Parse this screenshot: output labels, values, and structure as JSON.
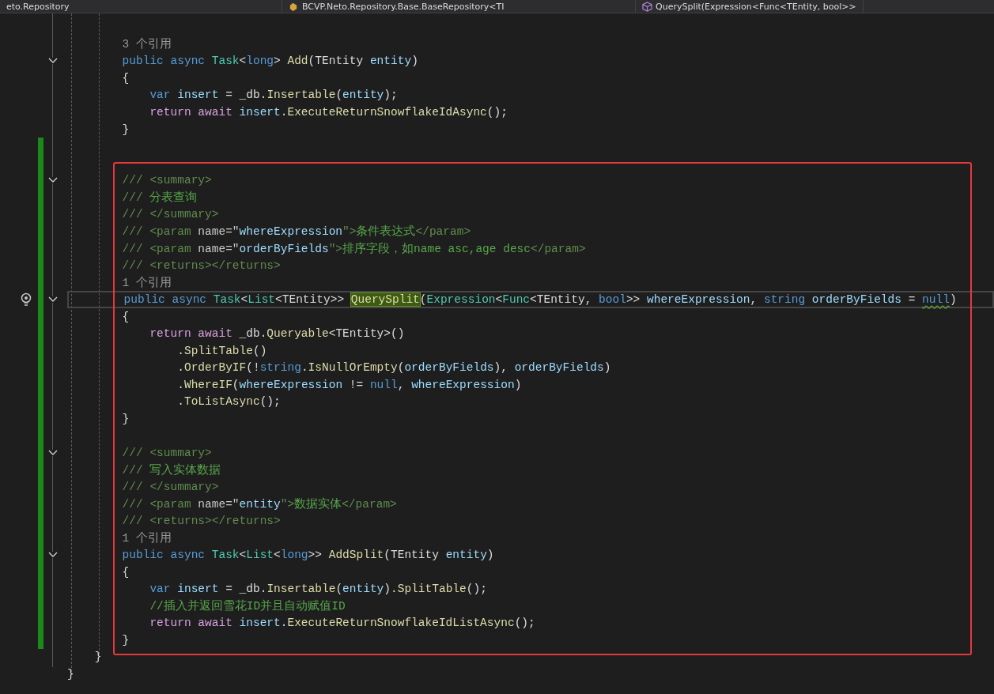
{
  "navigation_bar": [
    {
      "text": "eto.Repository"
    },
    {
      "text": "BCVP.Neto.Repository.Base.BaseRepository<TI"
    },
    {
      "text": "QuerySplit(Expression<Func<TEntity, bool>>"
    }
  ],
  "regions": [
    {
      "changed": false,
      "blocks": [
        {
          "lines": [
            {
              "tokens": [
                {
                  "text": "        3 个引用",
                  "kind": "lens"
                }
              ]
            },
            {
              "fold": true,
              "tokens": [
                {
                  "text": "        public async ",
                  "kind": "keyword"
                },
                {
                  "text": "Task",
                  "kind": "type"
                },
                {
                  "text": "<",
                  "kind": "plain"
                },
                {
                  "text": "long",
                  "kind": "keyword"
                },
                {
                  "text": "> ",
                  "kind": "plain"
                },
                {
                  "text": "Add",
                  "kind": "method"
                },
                {
                  "text": "(",
                  "kind": "plain"
                },
                {
                  "text": "TEntity ",
                  "kind": "plain"
                },
                {
                  "text": "entity",
                  "kind": "param"
                },
                {
                  "text": ")",
                  "kind": "plain"
                }
              ]
            },
            {
              "tokens": [
                {
                  "text": "        {",
                  "kind": "plain"
                }
              ]
            },
            {
              "tokens": [
                {
                  "text": "            var ",
                  "kind": "keyword"
                },
                {
                  "text": "insert",
                  "kind": "param"
                },
                {
                  "text": " = _db.",
                  "kind": "plain"
                },
                {
                  "text": "Insertable",
                  "kind": "method"
                },
                {
                  "text": "(",
                  "kind": "plain"
                },
                {
                  "text": "entity",
                  "kind": "param"
                },
                {
                  "text": ");",
                  "kind": "plain"
                }
              ]
            },
            {
              "tokens": [
                {
                  "text": "            return await ",
                  "kind": "control"
                },
                {
                  "text": "insert",
                  "kind": "param"
                },
                {
                  "text": ".",
                  "kind": "plain"
                },
                {
                  "text": "ExecuteReturnSnowflakeIdAsync",
                  "kind": "method"
                },
                {
                  "text": "();",
                  "kind": "plain"
                }
              ]
            },
            {
              "tokens": [
                {
                  "text": "        }",
                  "kind": "plain"
                }
              ]
            }
          ]
        }
      ]
    },
    {
      "changed": true,
      "blocks": [
        {
          "lines": [
            {
              "fold": true,
              "tokens": [
                {
                  "text": "        /// <summary>",
                  "kind": "doc"
                }
              ]
            },
            {
              "tokens": [
                {
                  "text": "        ///",
                  "kind": "doc"
                },
                {
                  "text": " 分表查询",
                  "kind": "comment"
                }
              ]
            },
            {
              "tokens": [
                {
                  "text": "        /// </summary>",
                  "kind": "doc"
                }
              ]
            },
            {
              "tokens": [
                {
                  "text": "        /// <param ",
                  "kind": "doc"
                },
                {
                  "text": "name=\"",
                  "kind": "attr"
                },
                {
                  "text": "whereExpression",
                  "kind": "param"
                },
                {
                  "text": "\">",
                  "kind": "doc"
                },
                {
                  "text": "条件表达式",
                  "kind": "comment"
                },
                {
                  "text": "</param>",
                  "kind": "doc"
                }
              ]
            },
            {
              "tokens": [
                {
                  "text": "        /// <param ",
                  "kind": "doc"
                },
                {
                  "text": "name=\"",
                  "kind": "attr"
                },
                {
                  "text": "orderByFields",
                  "kind": "param"
                },
                {
                  "text": "\">",
                  "kind": "doc"
                },
                {
                  "text": "排序字段，如name asc,age desc",
                  "kind": "comment"
                },
                {
                  "text": "</param>",
                  "kind": "doc"
                }
              ]
            },
            {
              "tokens": [
                {
                  "text": "        /// <returns></returns>",
                  "kind": "doc"
                }
              ]
            },
            {
              "tokens": [
                {
                  "text": "        1 个引用",
                  "kind": "lens"
                }
              ]
            },
            {
              "fold": true,
              "current": true,
              "lightbulb": true,
              "tokens": [
                {
                  "text": "        public async ",
                  "kind": "keyword"
                },
                {
                  "text": "Task",
                  "kind": "type"
                },
                {
                  "text": "<",
                  "kind": "plain"
                },
                {
                  "text": "List",
                  "kind": "type"
                },
                {
                  "text": "<",
                  "kind": "plain"
                },
                {
                  "text": "TEntity",
                  "kind": "plain"
                },
                {
                  "text": ">> ",
                  "kind": "plain"
                },
                {
                  "text": "QuerySplit",
                  "kind": "highlight"
                },
                {
                  "text": "(",
                  "kind": "plain"
                },
                {
                  "text": "Expression",
                  "kind": "type"
                },
                {
                  "text": "<",
                  "kind": "plain"
                },
                {
                  "text": "Func",
                  "kind": "type"
                },
                {
                  "text": "<",
                  "kind": "plain"
                },
                {
                  "text": "TEntity",
                  "kind": "plain"
                },
                {
                  "text": ", ",
                  "kind": "plain"
                },
                {
                  "text": "bool",
                  "kind": "keyword"
                },
                {
                  "text": ">> ",
                  "kind": "plain"
                },
                {
                  "text": "whereExpression",
                  "kind": "param"
                },
                {
                  "text": ", ",
                  "kind": "plain"
                },
                {
                  "text": "string ",
                  "kind": "keyword"
                },
                {
                  "text": "orderByFields",
                  "kind": "param"
                },
                {
                  "text": " = ",
                  "kind": "plain"
                },
                {
                  "text": "null",
                  "kind": "warning"
                },
                {
                  "text": ")",
                  "kind": "plain"
                }
              ]
            },
            {
              "tokens": [
                {
                  "text": "        {",
                  "kind": "plain"
                }
              ]
            },
            {
              "tokens": [
                {
                  "text": "            return await ",
                  "kind": "control"
                },
                {
                  "text": "_db.",
                  "kind": "plain"
                },
                {
                  "text": "Queryable",
                  "kind": "method"
                },
                {
                  "text": "<TEntity>()",
                  "kind": "plain"
                }
              ]
            },
            {
              "tokens": [
                {
                  "text": "                .",
                  "kind": "plain"
                },
                {
                  "text": "SplitTable",
                  "kind": "method"
                },
                {
                  "text": "()",
                  "kind": "plain"
                }
              ]
            },
            {
              "tokens": [
                {
                  "text": "                .",
                  "kind": "plain"
                },
                {
                  "text": "OrderByIF",
                  "kind": "method"
                },
                {
                  "text": "(!",
                  "kind": "plain"
                },
                {
                  "text": "string",
                  "kind": "keyword"
                },
                {
                  "text": ".",
                  "kind": "plain"
                },
                {
                  "text": "IsNullOrEmpty",
                  "kind": "method"
                },
                {
                  "text": "(",
                  "kind": "plain"
                },
                {
                  "text": "orderByFields",
                  "kind": "param"
                },
                {
                  "text": "), ",
                  "kind": "plain"
                },
                {
                  "text": "orderByFields",
                  "kind": "param"
                },
                {
                  "text": ")",
                  "kind": "plain"
                }
              ]
            },
            {
              "tokens": [
                {
                  "text": "                .",
                  "kind": "plain"
                },
                {
                  "text": "WhereIF",
                  "kind": "method"
                },
                {
                  "text": "(",
                  "kind": "plain"
                },
                {
                  "text": "whereExpression",
                  "kind": "param"
                },
                {
                  "text": " != ",
                  "kind": "plain"
                },
                {
                  "text": "null",
                  "kind": "keyword"
                },
                {
                  "text": ", ",
                  "kind": "plain"
                },
                {
                  "text": "whereExpression",
                  "kind": "param"
                },
                {
                  "text": ")",
                  "kind": "plain"
                }
              ]
            },
            {
              "tokens": [
                {
                  "text": "                .",
                  "kind": "plain"
                },
                {
                  "text": "ToListAsync",
                  "kind": "method"
                },
                {
                  "text": "();",
                  "kind": "plain"
                }
              ]
            },
            {
              "tokens": [
                {
                  "text": "        }",
                  "kind": "plain"
                }
              ]
            }
          ]
        },
        {
          "lines": [
            {
              "fold": true,
              "tokens": [
                {
                  "text": "        /// <summary>",
                  "kind": "doc"
                }
              ]
            },
            {
              "tokens": [
                {
                  "text": "        ///",
                  "kind": "doc"
                },
                {
                  "text": " 写入实体数据",
                  "kind": "comment"
                }
              ]
            },
            {
              "tokens": [
                {
                  "text": "        /// </summary>",
                  "kind": "doc"
                }
              ]
            },
            {
              "tokens": [
                {
                  "text": "        /// <param ",
                  "kind": "doc"
                },
                {
                  "text": "name=\"",
                  "kind": "attr"
                },
                {
                  "text": "entity",
                  "kind": "param"
                },
                {
                  "text": "\">",
                  "kind": "doc"
                },
                {
                  "text": "数据实体",
                  "kind": "comment"
                },
                {
                  "text": "</param>",
                  "kind": "doc"
                }
              ]
            },
            {
              "tokens": [
                {
                  "text": "        /// <returns></returns>",
                  "kind": "doc"
                }
              ]
            },
            {
              "tokens": [
                {
                  "text": "        1 个引用",
                  "kind": "lens"
                }
              ]
            },
            {
              "fold": true,
              "tokens": [
                {
                  "text": "        public async ",
                  "kind": "keyword"
                },
                {
                  "text": "Task",
                  "kind": "type"
                },
                {
                  "text": "<",
                  "kind": "plain"
                },
                {
                  "text": "List",
                  "kind": "type"
                },
                {
                  "text": "<",
                  "kind": "plain"
                },
                {
                  "text": "long",
                  "kind": "keyword"
                },
                {
                  "text": ">> ",
                  "kind": "plain"
                },
                {
                  "text": "AddSplit",
                  "kind": "method"
                },
                {
                  "text": "(",
                  "kind": "plain"
                },
                {
                  "text": "TEntity ",
                  "kind": "plain"
                },
                {
                  "text": "entity",
                  "kind": "param"
                },
                {
                  "text": ")",
                  "kind": "plain"
                }
              ]
            },
            {
              "tokens": [
                {
                  "text": "        {",
                  "kind": "plain"
                }
              ]
            },
            {
              "tokens": [
                {
                  "text": "            var ",
                  "kind": "keyword"
                },
                {
                  "text": "insert",
                  "kind": "param"
                },
                {
                  "text": " = _db.",
                  "kind": "plain"
                },
                {
                  "text": "Insertable",
                  "kind": "method"
                },
                {
                  "text": "(",
                  "kind": "plain"
                },
                {
                  "text": "entity",
                  "kind": "param"
                },
                {
                  "text": ").",
                  "kind": "plain"
                },
                {
                  "text": "SplitTable",
                  "kind": "method"
                },
                {
                  "text": "();",
                  "kind": "plain"
                }
              ]
            },
            {
              "tokens": [
                {
                  "text": "            //插入并返回雪花ID并且自动赋值ID",
                  "kind": "comment"
                }
              ]
            },
            {
              "tokens": [
                {
                  "text": "            return await ",
                  "kind": "control"
                },
                {
                  "text": "insert",
                  "kind": "param"
                },
                {
                  "text": ".",
                  "kind": "plain"
                },
                {
                  "text": "ExecuteReturnSnowflakeIdListAsync",
                  "kind": "method"
                },
                {
                  "text": "();",
                  "kind": "plain"
                }
              ]
            },
            {
              "tokens": [
                {
                  "text": "        }",
                  "kind": "plain"
                }
              ]
            }
          ]
        }
      ]
    },
    {
      "changed": false,
      "blocks": [
        {
          "lines": [
            {
              "tokens": [
                {
                  "text": "    }",
                  "kind": "plain"
                }
              ]
            },
            {
              "tokens": [
                {
                  "text": "}",
                  "kind": "plain"
                }
              ]
            }
          ]
        }
      ]
    }
  ]
}
